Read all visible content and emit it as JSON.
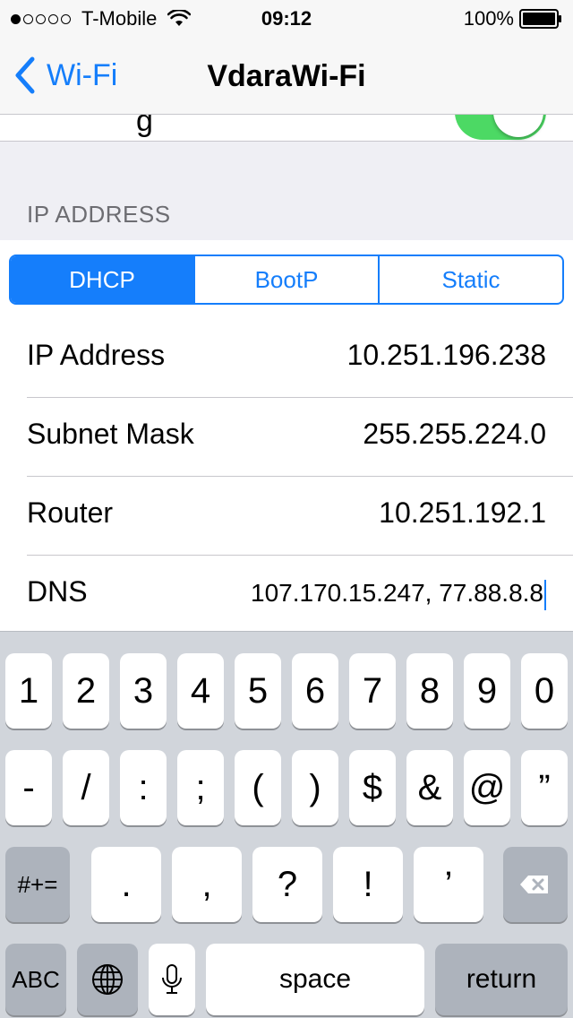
{
  "status_bar": {
    "signal_dots_filled": 1,
    "signal_dots_total": 5,
    "carrier": "T-Mobile",
    "time": "09:12",
    "battery_percent": "100%"
  },
  "nav": {
    "back_label": "Wi-Fi",
    "title": "VdaraWi-Fi"
  },
  "section": {
    "header": "IP ADDRESS"
  },
  "segments": [
    {
      "label": "DHCP",
      "selected": true
    },
    {
      "label": "BootP",
      "selected": false
    },
    {
      "label": "Static",
      "selected": false
    }
  ],
  "fields": {
    "ip_address": {
      "label": "IP Address",
      "value": "10.251.196.238"
    },
    "subnet_mask": {
      "label": "Subnet Mask",
      "value": "255.255.224.0"
    },
    "router": {
      "label": "Router",
      "value": "10.251.192.1"
    },
    "dns": {
      "label": "DNS",
      "value": "107.170.15.247, 77.88.8.8"
    }
  },
  "keyboard": {
    "row1": [
      "1",
      "2",
      "3",
      "4",
      "5",
      "6",
      "7",
      "8",
      "9",
      "0"
    ],
    "row2": [
      "-",
      "/",
      ":",
      ";",
      "(",
      ")",
      "$",
      "&",
      "@",
      "”"
    ],
    "row3": {
      "shift_label": "#+=",
      "keys": [
        ".",
        ",",
        "?",
        "!",
        "’"
      ],
      "delete": "delete-icon"
    },
    "row4": {
      "abc": "ABC",
      "globe": "globe-icon",
      "mic": "microphone-icon",
      "space": "space",
      "return": "return"
    }
  },
  "colors": {
    "accent": "#157efb",
    "toggle_on": "#4cd964",
    "keyboard_bg": "#d1d5db",
    "group_bg": "#efeff4"
  }
}
